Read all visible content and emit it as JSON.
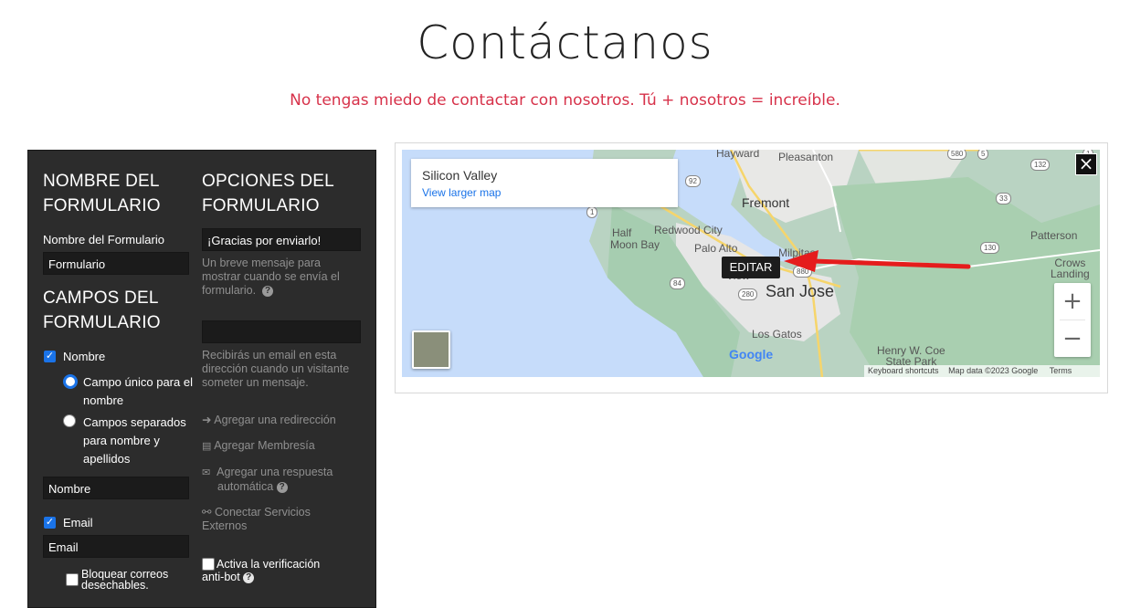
{
  "header": {
    "title": "Contáctanos",
    "subtitle": "No tengas miedo de contactar con nosotros. Tú + nosotros = increíble."
  },
  "editor": {
    "form_name_heading_1": "NOMBRE DEL",
    "form_name_heading_2": "FORMULARIO",
    "form_name_label": "Nombre del Formulario",
    "form_name_value": "Formulario",
    "fields_heading_1": "CAMPOS DEL",
    "fields_heading_2": "FORMULARIO",
    "name_checkbox_label": "Nombre",
    "radio_single_1": "Campo único para el",
    "radio_single_2": "nombre",
    "radio_split_1": "Campos separados",
    "radio_split_2": "para nombre y",
    "radio_split_3": "apellidos",
    "name_input_value": "Nombre",
    "email_checkbox_label": "Email",
    "email_input_value": "Email",
    "block_disposable_1": "Bloquear correos",
    "block_disposable_2": "desechables.",
    "options_heading_1": "OPCIONES DEL",
    "options_heading_2": "FORMULARIO",
    "thanks_value": "¡Gracias por enviarlo!",
    "thanks_help_1": "Un breve mensaje para",
    "thanks_help_2": "mostrar cuando se envía el",
    "thanks_help_3": "formulario.",
    "email_help_1": "Recibirás un email en esta",
    "email_help_2": "dirección cuando un visitante",
    "email_help_3": "someter un mensaje.",
    "add_redirect": "Agregar una redirección",
    "add_membership": "Agregar Membresía",
    "add_autoreply_1": "Agregar una respuesta",
    "add_autoreply_2": "automática",
    "connect_services_1": "Conectar Servicios",
    "connect_services_2": "Externos",
    "antibot_1": "Activa la verificación",
    "antibot_2": "anti-bot"
  },
  "map": {
    "place_title": "Silicon Valley",
    "larger_map_link": "View larger map",
    "edit_button": "EDITAR",
    "labels": {
      "hayward": "Hayward",
      "pleasanton": "Pleasanton",
      "fremont": "Fremont",
      "redwood": "Redwood City",
      "half1": "Half",
      "half2": "Moon Bay",
      "palo": "Palo Alto",
      "milpitas": "Milpitas",
      "view": "View",
      "sanjose": "San Jose",
      "losgatos": "Los Gatos",
      "patterson": "Patterson",
      "crows1": "Crows",
      "crows2": "Landing",
      "henry1": "Henry W. Coe",
      "henry2": "State Park"
    },
    "shields": [
      "580",
      "5",
      "132",
      "92",
      "1",
      "33",
      "130",
      "84",
      "280",
      "880",
      "1"
    ],
    "footer_shortcuts": "Keyboard shortcuts",
    "footer_data": "Map data ©2023 Google",
    "footer_terms": "Terms",
    "google_logo": "Google",
    "zoom_in": "+",
    "zoom_out": "−",
    "close": "×"
  }
}
